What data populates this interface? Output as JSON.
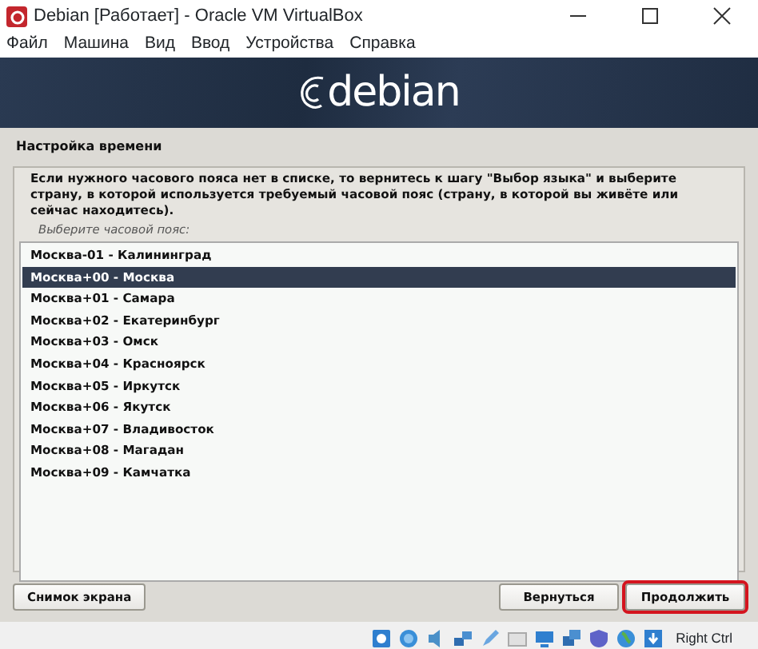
{
  "window": {
    "title": "Debian [Работает] - Oracle VM VirtualBox"
  },
  "menu": [
    "Файл",
    "Машина",
    "Вид",
    "Ввод",
    "Устройства",
    "Справка"
  ],
  "banner": {
    "logo_text": "debian"
  },
  "section_title": "Настройка времени",
  "description": "Если нужного часового пояса нет в списке, то вернитесь к шагу \"Выбор языка\" и выберите страну, в которой используется требуемый часовой пояс (страну, в которой вы живёте или сейчас находитесь).",
  "prompt": "Выберите часовой пояс:",
  "timezones": [
    {
      "label": "Москва-01 - Калининград",
      "selected": false
    },
    {
      "label": "Москва+00 - Москва",
      "selected": true
    },
    {
      "label": "Москва+01 - Самара",
      "selected": false
    },
    {
      "label": "Москва+02 - Екатеринбург",
      "selected": false
    },
    {
      "label": "Москва+03 - Омск",
      "selected": false
    },
    {
      "label": "Москва+04 - Красноярск",
      "selected": false
    },
    {
      "label": "Москва+05 - Иркутск",
      "selected": false
    },
    {
      "label": "Москва+06 - Якутск",
      "selected": false
    },
    {
      "label": "Москва+07 - Владивосток",
      "selected": false
    },
    {
      "label": "Москва+08 - Магадан",
      "selected": false
    },
    {
      "label": "Москва+09 - Камчатка",
      "selected": false
    }
  ],
  "buttons": {
    "left": [
      {
        "label": "Снимок экрана",
        "highlighted": false
      }
    ],
    "right": [
      {
        "label": "Вернуться",
        "highlighted": false
      },
      {
        "label": "Продолжить",
        "highlighted": true
      }
    ]
  },
  "status_bar": {
    "host_key": "Right Ctrl"
  }
}
